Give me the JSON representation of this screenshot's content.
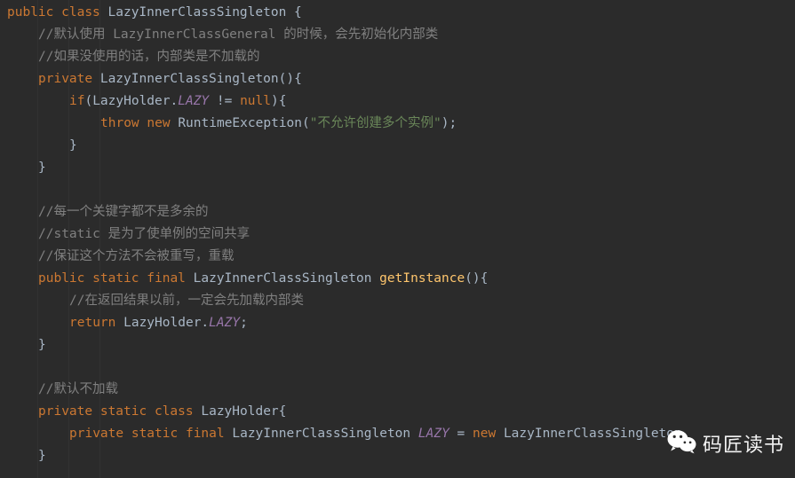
{
  "editor": {
    "theme": "darcula",
    "background": "#2b2b2b",
    "colors": {
      "keyword": "#cc7832",
      "identifier": "#a9b7c6",
      "comment": "#808080",
      "string": "#6a8759",
      "field": "#9876aa",
      "method": "#ffc66d",
      "guide": "#323232"
    },
    "language": "java",
    "lines": [
      {
        "id": "line-1",
        "indent": 0,
        "tokens": [
          {
            "t": "public",
            "c": "kw"
          },
          {
            "t": " ",
            "c": "pun"
          },
          {
            "t": "class",
            "c": "kw"
          },
          {
            "t": " ",
            "c": "pun"
          },
          {
            "t": "LazyInnerClassSingleton",
            "c": "cls"
          },
          {
            "t": " {",
            "c": "pun"
          }
        ]
      },
      {
        "id": "line-2",
        "indent": 1,
        "tokens": [
          {
            "t": "//默认使用 LazyInnerClassGeneral 的时候，会先初始化内部类",
            "c": "cmt"
          }
        ]
      },
      {
        "id": "line-3",
        "indent": 1,
        "tokens": [
          {
            "t": "//如果没使用的话，内部类是不加载的",
            "c": "cmt"
          }
        ]
      },
      {
        "id": "line-4",
        "indent": 1,
        "tokens": [
          {
            "t": "private",
            "c": "kw"
          },
          {
            "t": " ",
            "c": "pun"
          },
          {
            "t": "LazyInnerClassSingleton",
            "c": "cls"
          },
          {
            "t": "(){",
            "c": "pun"
          }
        ]
      },
      {
        "id": "line-5",
        "indent": 2,
        "tokens": [
          {
            "t": "if",
            "c": "kw"
          },
          {
            "t": "(LazyHolder.",
            "c": "pun"
          },
          {
            "t": "LAZY",
            "c": "fld"
          },
          {
            "t": " != ",
            "c": "pun"
          },
          {
            "t": "null",
            "c": "kw"
          },
          {
            "t": "){",
            "c": "pun"
          }
        ]
      },
      {
        "id": "line-6",
        "indent": 3,
        "tokens": [
          {
            "t": "throw",
            "c": "kw"
          },
          {
            "t": " ",
            "c": "pun"
          },
          {
            "t": "new",
            "c": "kw"
          },
          {
            "t": " ",
            "c": "pun"
          },
          {
            "t": "RuntimeException",
            "c": "cls"
          },
          {
            "t": "(",
            "c": "pun"
          },
          {
            "t": "\"不允许创建多个实例\"",
            "c": "str"
          },
          {
            "t": ");",
            "c": "pun"
          }
        ]
      },
      {
        "id": "line-7",
        "indent": 2,
        "tokens": [
          {
            "t": "}",
            "c": "pun"
          }
        ]
      },
      {
        "id": "line-8",
        "indent": 1,
        "tokens": [
          {
            "t": "}",
            "c": "pun"
          }
        ]
      },
      {
        "id": "line-9",
        "indent": 0,
        "tokens": []
      },
      {
        "id": "line-10",
        "indent": 1,
        "tokens": [
          {
            "t": "//每一个关键字都不是多余的",
            "c": "cmt"
          }
        ]
      },
      {
        "id": "line-11",
        "indent": 1,
        "tokens": [
          {
            "t": "//static 是为了使单例的空间共享",
            "c": "cmt"
          }
        ]
      },
      {
        "id": "line-12",
        "indent": 1,
        "tokens": [
          {
            "t": "//保证这个方法不会被重写，重载",
            "c": "cmt"
          }
        ]
      },
      {
        "id": "line-13",
        "indent": 1,
        "tokens": [
          {
            "t": "public",
            "c": "kw"
          },
          {
            "t": " ",
            "c": "pun"
          },
          {
            "t": "static",
            "c": "kw"
          },
          {
            "t": " ",
            "c": "pun"
          },
          {
            "t": "final",
            "c": "kw"
          },
          {
            "t": " ",
            "c": "pun"
          },
          {
            "t": "LazyInnerClassSingleton",
            "c": "cls"
          },
          {
            "t": " ",
            "c": "pun"
          },
          {
            "t": "getInstance",
            "c": "mth"
          },
          {
            "t": "(){",
            "c": "pun"
          }
        ]
      },
      {
        "id": "line-14",
        "indent": 2,
        "tokens": [
          {
            "t": "//在返回结果以前，一定会先加载内部类",
            "c": "cmt"
          }
        ]
      },
      {
        "id": "line-15",
        "indent": 2,
        "tokens": [
          {
            "t": "return",
            "c": "kw"
          },
          {
            "t": " LazyHolder.",
            "c": "pun"
          },
          {
            "t": "LAZY",
            "c": "fld"
          },
          {
            "t": ";",
            "c": "pun"
          }
        ]
      },
      {
        "id": "line-16",
        "indent": 1,
        "tokens": [
          {
            "t": "}",
            "c": "pun"
          }
        ]
      },
      {
        "id": "line-17",
        "indent": 0,
        "tokens": []
      },
      {
        "id": "line-18",
        "indent": 1,
        "tokens": [
          {
            "t": "//默认不加载",
            "c": "cmt"
          }
        ]
      },
      {
        "id": "line-19",
        "indent": 1,
        "tokens": [
          {
            "t": "private",
            "c": "kw"
          },
          {
            "t": " ",
            "c": "pun"
          },
          {
            "t": "static",
            "c": "kw"
          },
          {
            "t": " ",
            "c": "pun"
          },
          {
            "t": "class",
            "c": "kw"
          },
          {
            "t": " ",
            "c": "pun"
          },
          {
            "t": "LazyHolder",
            "c": "cls"
          },
          {
            "t": "{",
            "c": "pun"
          }
        ]
      },
      {
        "id": "line-20",
        "indent": 2,
        "tokens": [
          {
            "t": "private",
            "c": "kw"
          },
          {
            "t": " ",
            "c": "pun"
          },
          {
            "t": "static",
            "c": "kw"
          },
          {
            "t": " ",
            "c": "pun"
          },
          {
            "t": "final",
            "c": "kw"
          },
          {
            "t": " ",
            "c": "pun"
          },
          {
            "t": "LazyInnerClassSingleton",
            "c": "cls"
          },
          {
            "t": " ",
            "c": "pun"
          },
          {
            "t": "LAZY",
            "c": "fld"
          },
          {
            "t": " = ",
            "c": "pun"
          },
          {
            "t": "new",
            "c": "kw"
          },
          {
            "t": " ",
            "c": "pun"
          },
          {
            "t": "LazyInnerClassSingleton",
            "c": "cls"
          }
        ]
      },
      {
        "id": "line-21",
        "indent": 1,
        "tokens": [
          {
            "t": "}",
            "c": "pun"
          }
        ]
      }
    ]
  },
  "watermark": {
    "icon": "wechat-icon",
    "text": "码匠读书"
  }
}
